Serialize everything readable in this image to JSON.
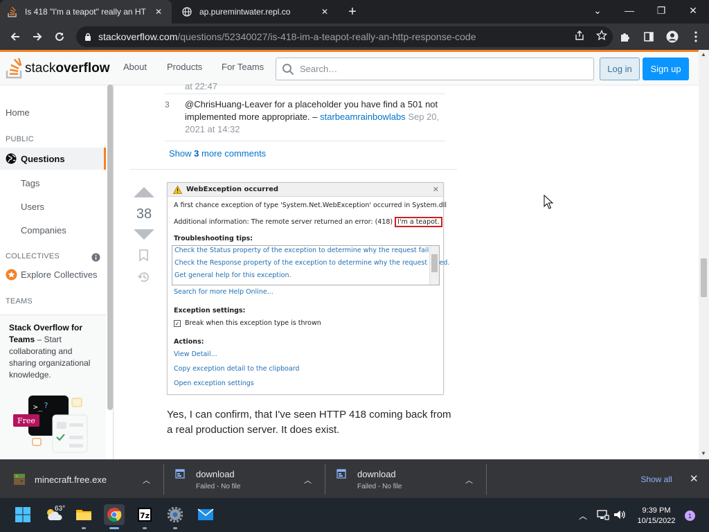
{
  "browser": {
    "tabs": [
      {
        "title": "Is 418 \"I'm a teapot\" really an HT",
        "active": true
      },
      {
        "title": "ap.puremintwater.repl.co",
        "active": false
      }
    ],
    "url_host": "stackoverflow.com",
    "url_path": "/questions/52340027/is-418-im-a-teapot-really-an-http-response-code"
  },
  "so_header": {
    "logo_light": "stack",
    "logo_bold": "overflow",
    "nav": [
      "About",
      "Products",
      "For Teams"
    ],
    "search_placeholder": "Search…",
    "login_label": "Log in",
    "signup_label": "Sign up"
  },
  "left_nav": {
    "home": "Home",
    "public_label": "PUBLIC",
    "questions": "Questions",
    "tags": "Tags",
    "users": "Users",
    "companies": "Companies",
    "collectives_label": "COLLECTIVES",
    "explore_collectives": "Explore Collectives",
    "teams_label": "TEAMS",
    "teams_title": "Stack Overflow for Teams",
    "teams_text": " – Start collaborating and sharing organizational knowledge.",
    "free_badge": "Free"
  },
  "comments": {
    "partial_text": "at 22:47",
    "items": [
      {
        "score": "3",
        "text": "@ChrisHuang-Leaver for a placeholder you have find a 501 not implemented more appropriate. – ",
        "user": "starbeamrainbowlabs",
        "date": "Sep 20, 2021 at 14:32"
      }
    ],
    "show_more_pre": "Show ",
    "show_more_count": "3",
    "show_more_post": " more comments"
  },
  "answer": {
    "votes": "38",
    "dialog": {
      "title": "WebException occurred",
      "line1": "A first chance exception of type 'System.Net.WebException' occurred in System.dll",
      "line2_pre": "Additional information: The remote server returned an error: (418)",
      "line2_highlight": "I'm a teapot.",
      "troubleshooting_label": "Troubleshooting tips:",
      "tips": [
        "Check the Status property of the exception to determine why the request failed.",
        "Check the Response property of the exception to determine why the request failed.",
        "Get general help for this exception."
      ],
      "help_link": "Search for more Help Online...",
      "exception_settings_label": "Exception settings:",
      "checkbox_label": "Break when this exception type is thrown",
      "actions_label": "Actions:",
      "actions": [
        "View Detail...",
        "Copy exception detail to the clipboard",
        "Open exception settings"
      ]
    },
    "text": "Yes, I can confirm, that I've seen HTTP 418 coming back from a real production server. It does exist."
  },
  "downloads": {
    "items": [
      {
        "name": "minecraft.free.exe",
        "status": ""
      },
      {
        "name": "download",
        "status": "Failed - No file"
      },
      {
        "name": "download",
        "status": "Failed - No file"
      }
    ],
    "show_all": "Show all"
  },
  "taskbar": {
    "temperature": "63°",
    "time": "9:39 PM",
    "date": "10/15/2022",
    "notification_count": "1"
  },
  "colors": {
    "so_orange": "#f48225",
    "so_blue": "#0a95ff",
    "link": "#0074cc",
    "browser_dark": "#202124"
  }
}
